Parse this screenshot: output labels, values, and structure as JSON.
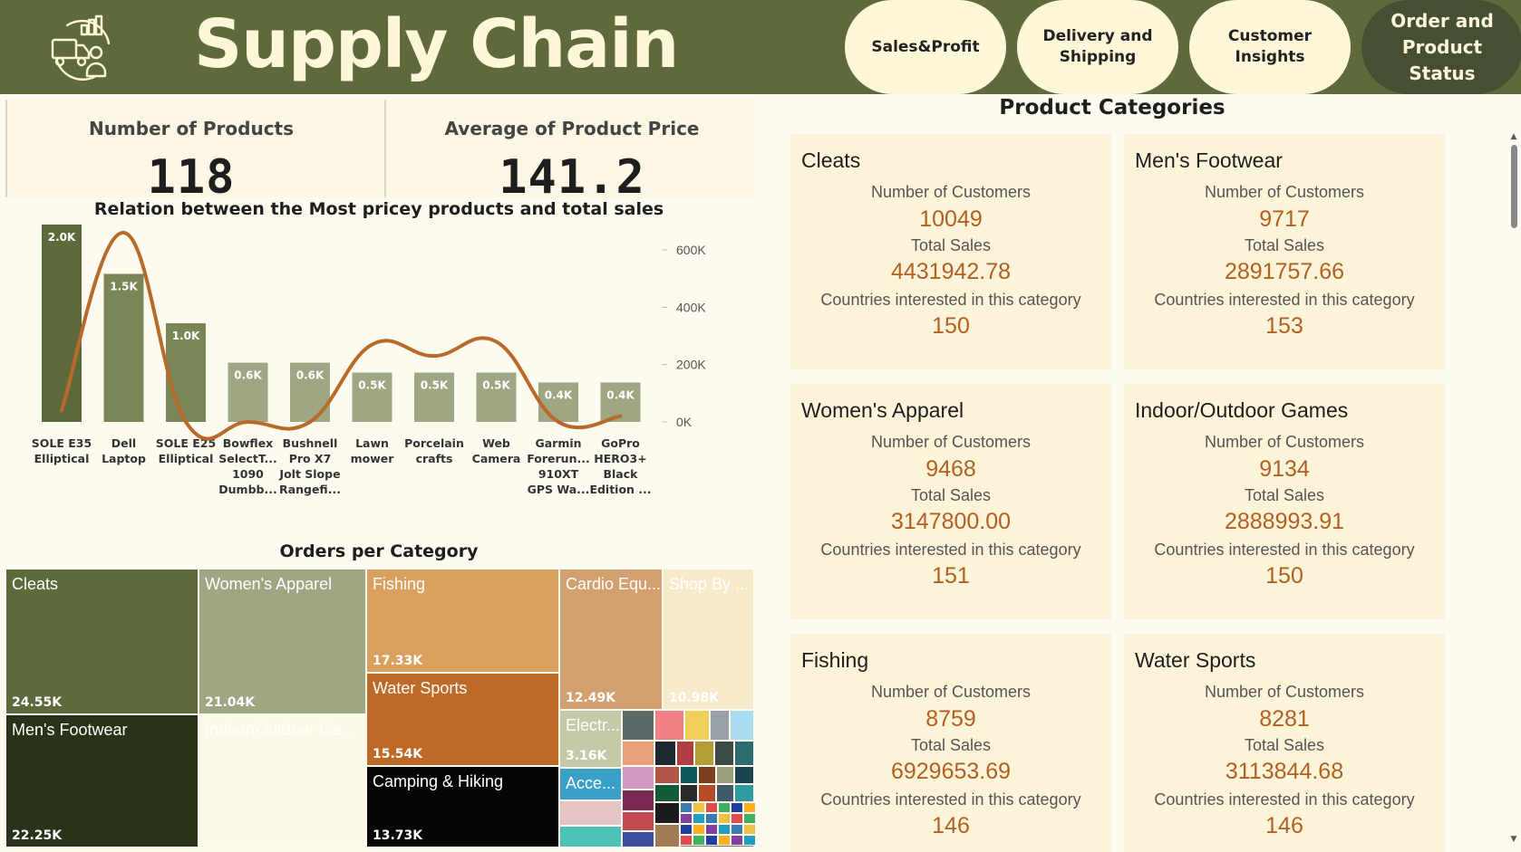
{
  "header": {
    "title": "Supply Chain",
    "nav": [
      {
        "label": "Sales&Profit"
      },
      {
        "label": "Delivery and Shipping"
      },
      {
        "label": "Customer Insights"
      },
      {
        "label": "Order and Product Status"
      }
    ],
    "colors": {
      "header_bg": "#5e6a3b",
      "pill_bg": "#fdf6d8",
      "active_pill_bg": "#474f32"
    }
  },
  "kpis": [
    {
      "label": "Number of Products",
      "value": "118"
    },
    {
      "label": "Average of Product Price",
      "value": "141.2"
    }
  ],
  "chart_title": "Relation between the Most pricey products and total sales",
  "chart_data": {
    "type": "bar",
    "title": "Relation between the Most pricey products and total sales",
    "categories": [
      "SOLE E35 Elliptical",
      "Dell Laptop",
      "SOLE E25 Elliptical",
      "Bowflex SelectT... 1090 Dumbb...",
      "Bushnell Pro X7 Jolt Slope Rangefi...",
      "Lawn mower",
      "Porcelain crafts",
      "Web Camera",
      "Garmin Forerun... 910XT GPS Wa...",
      "GoPro HERO3+ Black Edition ..."
    ],
    "category_lines": [
      [
        "SOLE E35",
        "Elliptical"
      ],
      [
        "Dell",
        "Laptop"
      ],
      [
        "SOLE E25",
        "Elliptical"
      ],
      [
        "Bowflex",
        "SelectT...",
        "1090",
        "Dumbb..."
      ],
      [
        "Bushnell",
        "Pro X7",
        "Jolt Slope",
        "Rangefi..."
      ],
      [
        "Lawn",
        "mower"
      ],
      [
        "Porcelain",
        "crafts"
      ],
      [
        "Web",
        "Camera"
      ],
      [
        "Garmin",
        "Forerun...",
        "910XT",
        "GPS Wa..."
      ],
      [
        "GoPro",
        "HERO3+",
        "Black",
        "Edition ..."
      ]
    ],
    "series": [
      {
        "values": [
          2000,
          1500,
          1000,
          600,
          600,
          500,
          500,
          500,
          400,
          400
        ],
        "labels": [
          "2.0K",
          "1.5K",
          "1.0K",
          "0.6K",
          "0.6K",
          "0.5K",
          "0.5K",
          "0.5K",
          "0.4K",
          "0.4K"
        ],
        "axis": "left"
      },
      {
        "type": "line",
        "values": [
          40000,
          660000,
          0,
          0,
          0,
          270000,
          230000,
          280000,
          0,
          20000
        ],
        "axis": "right"
      }
    ],
    "ylim": [
      0,
      2000
    ],
    "y2lim": [
      0,
      600000
    ],
    "y2_ticks": [
      "0K",
      "200K",
      "400K",
      "600K"
    ],
    "colors": {
      "bar_top": "#5e6a3b",
      "bar_mid": "#7a8558",
      "bar_light": "#9fa683",
      "line": "#b86a2a"
    }
  },
  "treemap": {
    "title": "Orders per Category",
    "cells": [
      {
        "name": "Cleats",
        "value": "24.55K",
        "color": "#5e6a3b"
      },
      {
        "name": "Women's Apparel",
        "value": "21.04K",
        "color": "#9fa683"
      },
      {
        "name": "Fishing",
        "value": "17.33K",
        "color": "#daa05f"
      },
      {
        "name": "Cardio Equ...",
        "value": "12.49K",
        "color": "#d3a070"
      },
      {
        "name": "Shop By ...",
        "value": "10.98K",
        "color": "#f7eacb"
      },
      {
        "name": "Water Sports",
        "value": "15.54K",
        "color": "#bd6a28"
      },
      {
        "name": "Men's Footwear",
        "value": "22.25K",
        "color": "#283319"
      },
      {
        "name": "Indoor/Outdoor Ga...",
        "value": "",
        "color": "#fdf9e8"
      },
      {
        "name": "Camping & Hiking",
        "value": "13.73K",
        "color": "#050505"
      },
      {
        "name": "Electr...",
        "value": "3.16K",
        "color": "#c5c9a8"
      },
      {
        "name": "Acce...",
        "value": "",
        "color": "#3aa0c8"
      }
    ]
  },
  "product_categories": {
    "title": "Product Categories",
    "labels": {
      "customers": "Number of Customers",
      "sales": "Total Sales",
      "countries": "Countries interested in this category"
    },
    "cards": [
      {
        "name": "Cleats",
        "customers": "10049",
        "sales": "4431942.78",
        "countries": "150"
      },
      {
        "name": "Men's Footwear",
        "customers": "9717",
        "sales": "2891757.66",
        "countries": "153"
      },
      {
        "name": "Women's Apparel",
        "customers": "9468",
        "sales": "3147800.00",
        "countries": "151"
      },
      {
        "name": "Indoor/Outdoor Games",
        "customers": "9134",
        "sales": "2888993.91",
        "countries": "150"
      },
      {
        "name": "Fishing",
        "customers": "8759",
        "sales": "6929653.69",
        "countries": "146"
      },
      {
        "name": "Water Sports",
        "customers": "8281",
        "sales": "3113844.68",
        "countries": "146"
      }
    ]
  }
}
